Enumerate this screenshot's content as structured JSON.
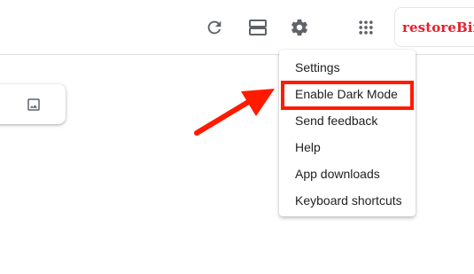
{
  "toolbar": {
    "icons": [
      "refresh-icon",
      "list-view-icon",
      "gear-icon",
      "apps-grid-icon"
    ]
  },
  "brand": {
    "label": "restoreBin",
    "color": "#e4202d"
  },
  "note_card": {
    "icon": "image-icon"
  },
  "settings_menu": {
    "items": [
      "Settings",
      "Enable Dark Mode",
      "Send feedback",
      "Help",
      "App downloads",
      "Keyboard shortcuts"
    ],
    "highlighted_item": "Enable Dark Mode"
  },
  "annotation": {
    "arrow_color": "#ff1a00",
    "highlight_color": "#ff1a00"
  }
}
